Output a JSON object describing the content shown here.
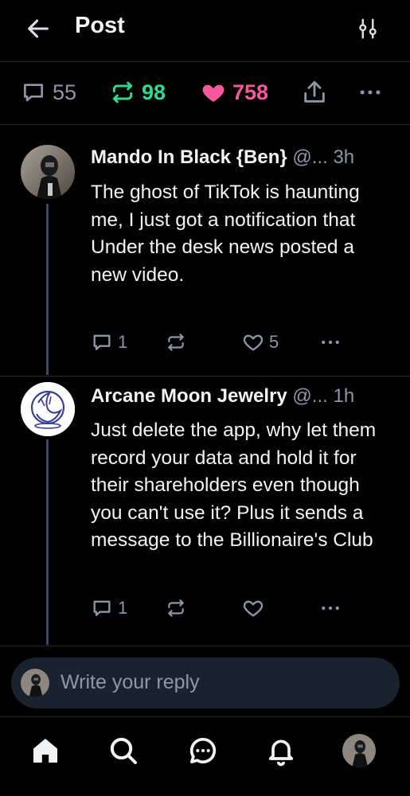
{
  "header": {
    "title": "Post",
    "back_icon": "arrow-left-icon",
    "filter_icon": "sliders-icon"
  },
  "stats": {
    "replies": "55",
    "reposts": "98",
    "likes": "758",
    "colors": {
      "muted": "#8b98a5",
      "repost": "#2fd98f",
      "like": "#f7579c"
    }
  },
  "posts": [
    {
      "author": "Mando In Black {Ben}",
      "handle": "@...",
      "time": "3h",
      "text": "The ghost of TikTok is haunting me, I just got a notification that Under the desk news posted a new video.",
      "reply_count": "1",
      "repost_count": "",
      "like_count": "5"
    },
    {
      "author": "Arcane Moon Jewelry",
      "handle": "@...",
      "time": "1h",
      "text": "Just delete the app, why let them record your data and hold it for their shareholders even though you can't use it? Plus it sends a message to the Billionaire's Club",
      "reply_count": "1",
      "repost_count": "",
      "like_count": ""
    }
  ],
  "reply_box": {
    "placeholder": "Write your reply"
  },
  "tabbar": {
    "items": [
      "home-icon",
      "search-icon",
      "chat-icon",
      "bell-icon",
      "profile-avatar"
    ]
  }
}
